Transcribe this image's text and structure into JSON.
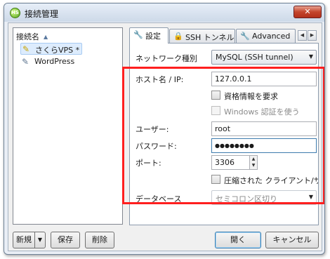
{
  "window": {
    "title": "接続管理",
    "app_icon_text": "HS",
    "close_symbol": "✕"
  },
  "sidebar": {
    "column_header": "接続名",
    "sort_symbol": "▲",
    "items": [
      {
        "label": "さくらVPS *",
        "selected": true
      },
      {
        "label": "WordPress",
        "selected": false
      }
    ]
  },
  "tabs": [
    {
      "label": "設定",
      "active": true
    },
    {
      "label": "SSH トンネル",
      "active": false
    },
    {
      "label": "Advanced",
      "active": false
    }
  ],
  "tab_scroll": {
    "left": "◀",
    "right": "▶"
  },
  "form": {
    "network_type": {
      "label": "ネットワーク種別",
      "value": "MySQL (SSH tunnel)"
    },
    "host": {
      "label": "ホスト名 / IP:",
      "value": "127.0.0.1"
    },
    "require_credentials": {
      "label": "資格情報を要求",
      "checked": false
    },
    "windows_auth": {
      "label": "Windows 認証を使う",
      "checked": false,
      "disabled": true
    },
    "user": {
      "label": "ユーザー:",
      "value": "root"
    },
    "password": {
      "label": "パスワード:",
      "value": "●●●●●●●●"
    },
    "port": {
      "label": "ポート:",
      "value": "3306",
      "up": "▲",
      "down": "▼"
    },
    "compressed": {
      "label": "圧縮された クライアント/サ",
      "checked": false
    },
    "database": {
      "label": "データベース",
      "placeholder": "セミコロン区切り"
    }
  },
  "buttons": {
    "new": "新規",
    "new_arrow": "▼",
    "save": "保存",
    "delete": "削除",
    "open": "開く",
    "cancel": "キャンセル"
  },
  "select_arrow": "▼",
  "colors": {
    "highlight": "#ff1f1f",
    "selection": "#ddecfd"
  },
  "icons": {
    "tab_settings": "wrench-icon",
    "tab_ssh": "lock-icon",
    "tab_advanced": "wrench-icon",
    "session": "pin-icon"
  }
}
